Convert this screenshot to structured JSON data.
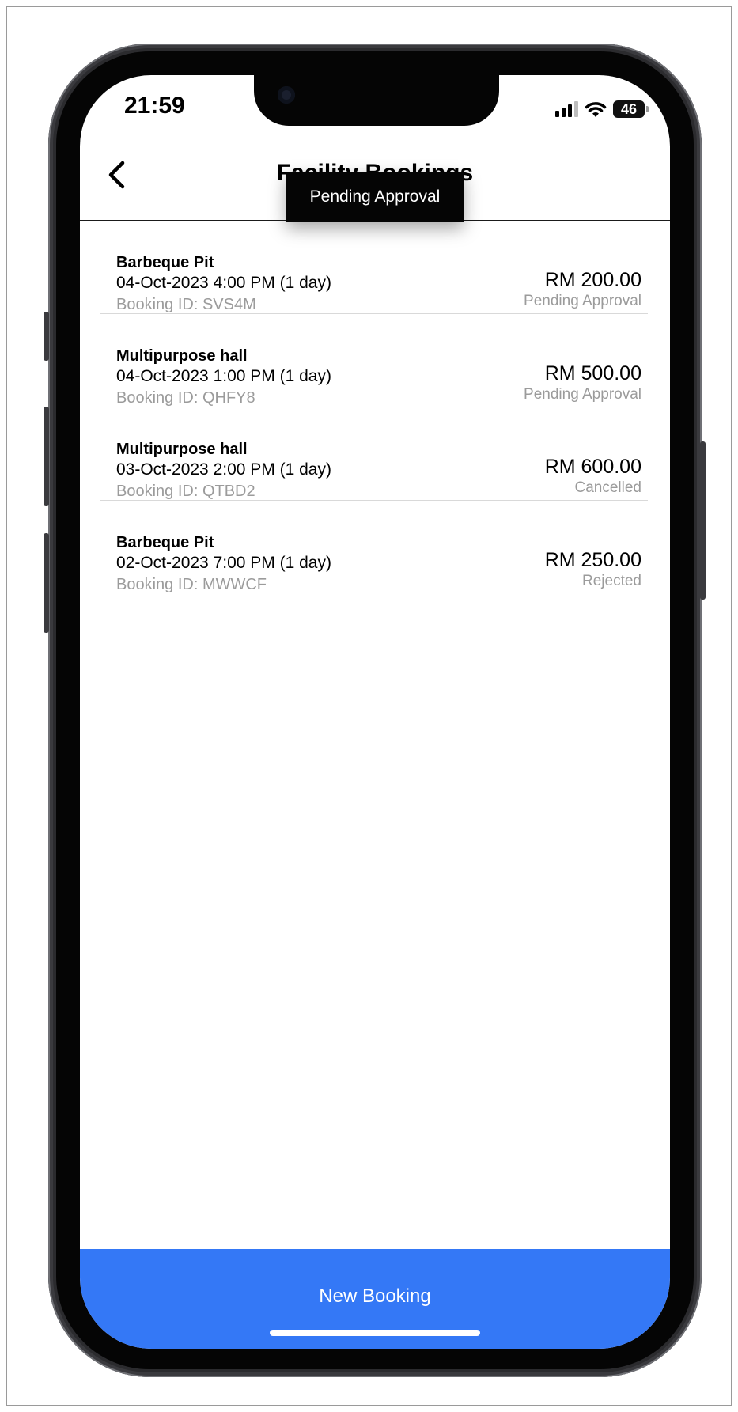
{
  "status_bar": {
    "time": "21:59",
    "battery": "46"
  },
  "header": {
    "title": "Facility Bookings",
    "back_icon": "chevron-left-icon"
  },
  "tooltip": {
    "text": "Pending Approval"
  },
  "bookings": [
    {
      "facility": "Barbeque Pit",
      "datetime": "04-Oct-2023 4:00 PM (1 day)",
      "booking_id": "Booking ID: SVS4M",
      "amount": "RM 200.00",
      "status": "Pending Approval"
    },
    {
      "facility": "Multipurpose hall",
      "datetime": "04-Oct-2023 1:00 PM (1 day)",
      "booking_id": "Booking ID: QHFY8",
      "amount": "RM 500.00",
      "status": "Pending Approval"
    },
    {
      "facility": "Multipurpose hall",
      "datetime": "03-Oct-2023 2:00 PM (1 day)",
      "booking_id": "Booking ID: QTBD2",
      "amount": "RM 600.00",
      "status": "Cancelled"
    },
    {
      "facility": "Barbeque Pit",
      "datetime": "02-Oct-2023 7:00 PM (1 day)",
      "booking_id": "Booking ID: MWWCF",
      "amount": "RM 250.00",
      "status": "Rejected"
    }
  ],
  "footer": {
    "new_booking_label": "New Booking"
  },
  "colors": {
    "accent": "#3478f6",
    "muted_text": "#9b9b9b",
    "divider": "#d9d9d9"
  }
}
